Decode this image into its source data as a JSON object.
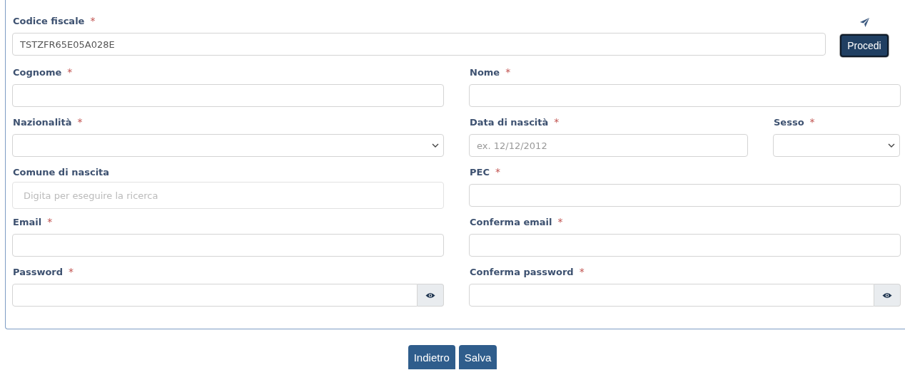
{
  "codice_fiscale": {
    "label": "Codice fiscale",
    "required_mark": "*",
    "value": "TSTZFR65E05A028E",
    "button": "Procedi"
  },
  "rows": [
    {
      "fields": [
        {
          "kind": "text",
          "label": "Cognome",
          "required_mark": "*"
        },
        {
          "kind": "text",
          "label": "Nome",
          "required_mark": "*"
        }
      ]
    },
    {
      "fields": [
        {
          "kind": "select",
          "label": "Nazionalità",
          "required_mark": "*"
        },
        {
          "kind": "date",
          "label": "Data di nascità",
          "required_mark": "*",
          "placeholder": "ex. 12/12/2012"
        },
        {
          "kind": "select",
          "label": "Sesso",
          "required_mark": "*"
        }
      ]
    },
    {
      "fields": [
        {
          "kind": "search",
          "label": "Comune di nascita",
          "placeholder": "Digita per eseguire la ricerca"
        },
        {
          "kind": "text",
          "label": "PEC",
          "required_mark": "*"
        }
      ]
    },
    {
      "fields": [
        {
          "kind": "text",
          "label": "Email",
          "required_mark": "*"
        },
        {
          "kind": "text",
          "label": "Conferma email",
          "required_mark": "*"
        }
      ]
    },
    {
      "fields": [
        {
          "kind": "password",
          "label": "Password",
          "required_mark": "*"
        },
        {
          "kind": "password",
          "label": "Conferma password",
          "required_mark": "*"
        }
      ]
    }
  ],
  "buttons": [
    "Indietro",
    "Salva"
  ]
}
